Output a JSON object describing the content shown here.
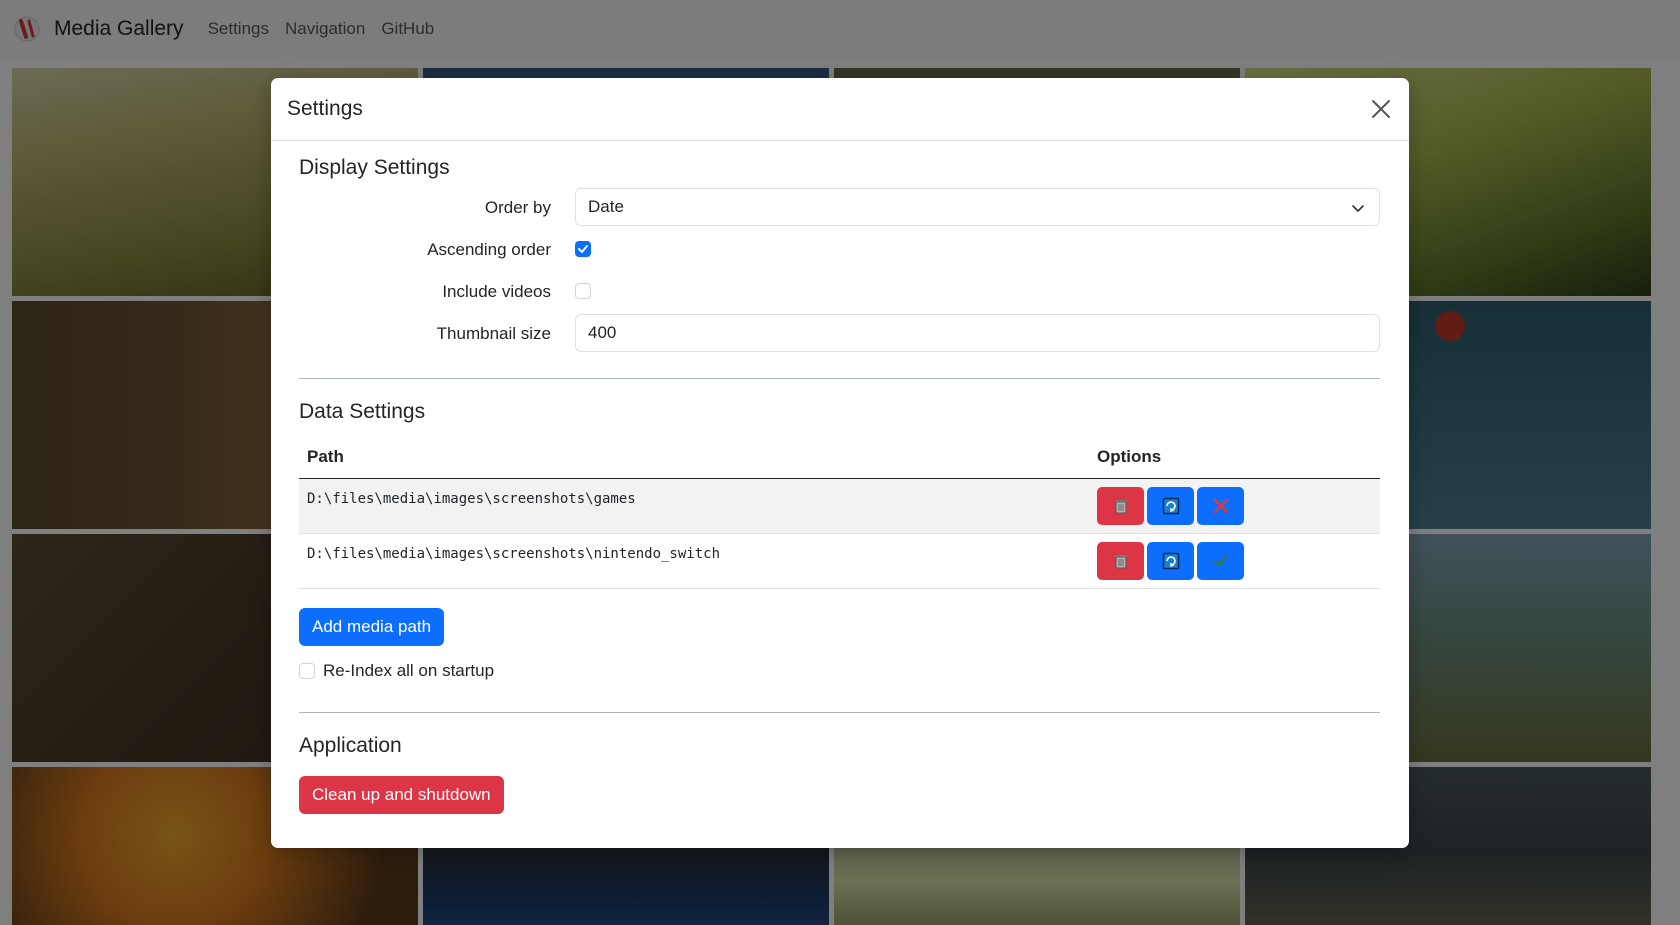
{
  "navbar": {
    "title": "Media Gallery",
    "links": [
      "Settings",
      "Navigation",
      "GitHub"
    ]
  },
  "modal": {
    "title": "Settings",
    "display": {
      "heading": "Display Settings",
      "order_by_label": "Order by",
      "order_by_value": "Date",
      "ascending_label": "Ascending order",
      "ascending_checked": true,
      "videos_label": "Include videos",
      "videos_checked": false,
      "thumb_label": "Thumbnail size",
      "thumb_value": "400"
    },
    "data": {
      "heading": "Data Settings",
      "col_path": "Path",
      "col_options": "Options",
      "paths": [
        {
          "path": "D:\\files\\media\\images\\screenshots\\games",
          "enabled": false
        },
        {
          "path": "D:\\files\\media\\images\\screenshots\\nintendo_switch",
          "enabled": true
        }
      ],
      "add_button": "Add media path",
      "reindex_label": "Re-Index all on startup",
      "reindex_checked": false
    },
    "app": {
      "heading": "Application",
      "shutdown_button": "Clean up and shutdown"
    }
  },
  "colors": {
    "primary": "#0d6efd",
    "danger": "#dc3545"
  }
}
